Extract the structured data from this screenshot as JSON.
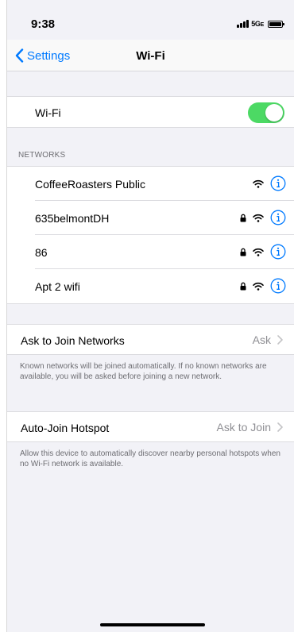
{
  "status_bar": {
    "time": "9:38",
    "network": "5G",
    "network_suffix": "E"
  },
  "nav": {
    "back_label": "Settings",
    "title": "Wi-Fi"
  },
  "wifi_toggle": {
    "label": "Wi-Fi",
    "on": true,
    "color": "#4cd964"
  },
  "networks": {
    "header": "NETWORKS",
    "items": [
      {
        "name": "CoffeeRoasters Public",
        "secured": false
      },
      {
        "name": "635belmontDH",
        "secured": true
      },
      {
        "name": "86",
        "secured": true
      },
      {
        "name": "Apt 2 wifi",
        "secured": true
      }
    ]
  },
  "ask_to_join": {
    "label": "Ask to Join Networks",
    "value": "Ask",
    "footnote": "Known networks will be joined automatically. If no known networks are available, you will be asked before joining a new network."
  },
  "auto_join_hotspot": {
    "label": "Auto-Join Hotspot",
    "value": "Ask to Join",
    "footnote": "Allow this device to automatically discover nearby personal hotspots when no Wi-Fi network is available."
  },
  "accent_color": "#007aff"
}
